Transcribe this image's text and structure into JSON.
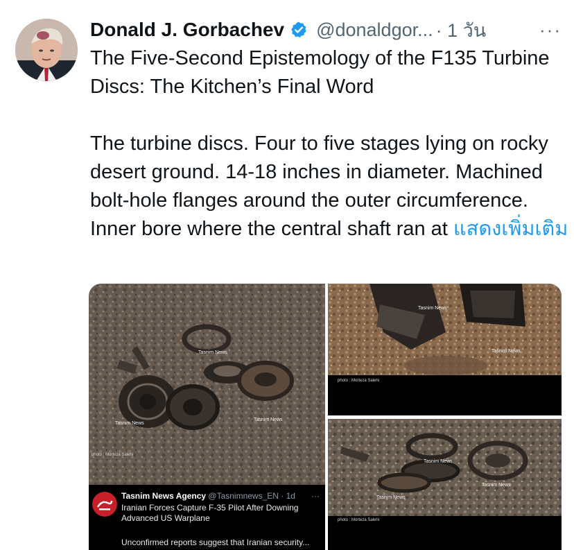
{
  "tweet": {
    "author_name": "Donald J. Gorbachev",
    "handle": "@donaldgor...",
    "time": "· 1 วัน",
    "more": "···",
    "paragraph1": "The Five-Second Epistemology of the F135 Turbine Discs: The Kitchen’s Final Word",
    "paragraph2": "The turbine discs. Four to five stages lying on rocky desert ground. 14-18 inches in diameter. Machined bolt-hole flanges around the outer circumference. Inner bore where the central shaft ran at",
    "show_more": "แสดงเพิ่มเติม"
  },
  "media": {
    "watermark": "Tasnim News",
    "photo_credit": "photo : Morteza Salehi",
    "quoted": {
      "name": "Tasnim News Agency",
      "handle": "@Tasnimnews_EN · 1d",
      "more": "···",
      "line1": "Iranian Forces Capture F-35 Pilot After Downing",
      "line2": "Advanced US Warplane",
      "footer": "Unconfirmed reports suggest that Iranian security..."
    }
  },
  "colors": {
    "link": "#1d9bf0",
    "verified": "#1d9bf0",
    "muted": "#536471"
  },
  "icons": {
    "verified": "verified-badge-icon",
    "more": "more-options-icon"
  }
}
